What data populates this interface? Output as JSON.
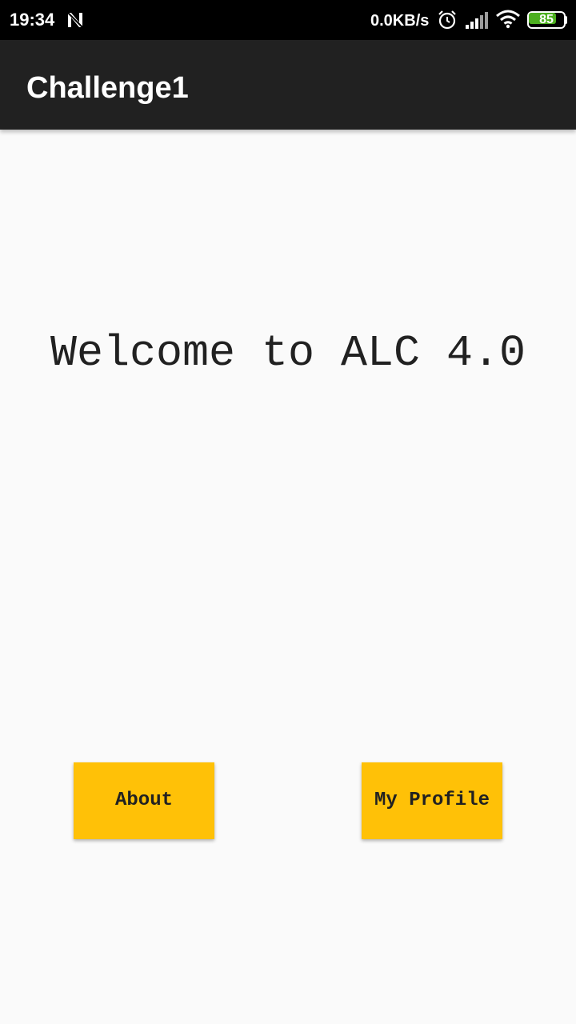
{
  "status_bar": {
    "time": "19:34",
    "net_speed": "0.0KB/s",
    "battery_level": "85",
    "icons": [
      "notification-n-icon",
      "alarm-icon",
      "signal-icon",
      "wifi-icon",
      "battery-icon"
    ],
    "battery_fraction": 0.85
  },
  "app_bar": {
    "title": "Challenge1"
  },
  "main": {
    "welcome_text": "Welcome to ALC 4.0",
    "buttons": {
      "about": "About",
      "profile": "My Profile"
    }
  },
  "colors": {
    "status_bar": "#000000",
    "app_bar": "#212121",
    "background": "#fafafa",
    "button": "#ffc107",
    "battery": "#4caf1f"
  }
}
